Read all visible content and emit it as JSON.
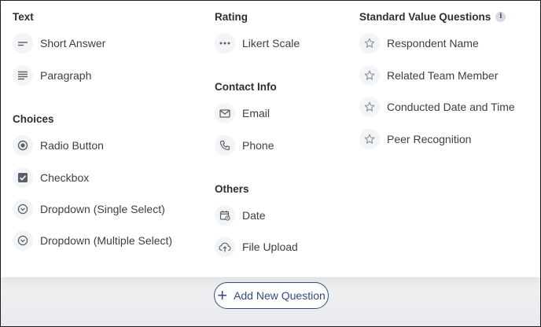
{
  "sections": {
    "text": {
      "heading": "Text",
      "items": [
        {
          "label": "Short Answer",
          "icon": "short-answer-icon"
        },
        {
          "label": "Paragraph",
          "icon": "paragraph-icon"
        }
      ]
    },
    "choices": {
      "heading": "Choices",
      "items": [
        {
          "label": "Radio Button",
          "icon": "radio-icon"
        },
        {
          "label": "Checkbox",
          "icon": "checkbox-icon"
        },
        {
          "label": "Dropdown (Single Select)",
          "icon": "chevron-circle-icon"
        },
        {
          "label": "Dropdown (Multiple Select)",
          "icon": "chevron-circle-icon"
        }
      ]
    },
    "rating": {
      "heading": "Rating",
      "items": [
        {
          "label": "Likert Scale",
          "icon": "dots-icon"
        }
      ]
    },
    "contact": {
      "heading": "Contact Info",
      "items": [
        {
          "label": "Email",
          "icon": "mail-icon"
        },
        {
          "label": "Phone",
          "icon": "phone-icon"
        }
      ]
    },
    "others": {
      "heading": "Others",
      "items": [
        {
          "label": "Date",
          "icon": "calendar-icon"
        },
        {
          "label": "File Upload",
          "icon": "cloud-upload-icon"
        }
      ]
    },
    "standard": {
      "heading": "Standard Value Questions",
      "info_glyph": "i",
      "items": [
        {
          "label": "Respondent Name",
          "icon": "star-icon"
        },
        {
          "label": "Related Team Member",
          "icon": "star-icon"
        },
        {
          "label": "Conducted Date and Time",
          "icon": "star-icon"
        },
        {
          "label": "Peer Recognition",
          "icon": "star-icon"
        }
      ]
    }
  },
  "add_button": {
    "label": "Add New Question",
    "glyph": "+"
  },
  "colors": {
    "accent": "#2f4d8c",
    "text": "#3a3f47",
    "heading": "#2b2f36",
    "icon": "#5a606b"
  }
}
